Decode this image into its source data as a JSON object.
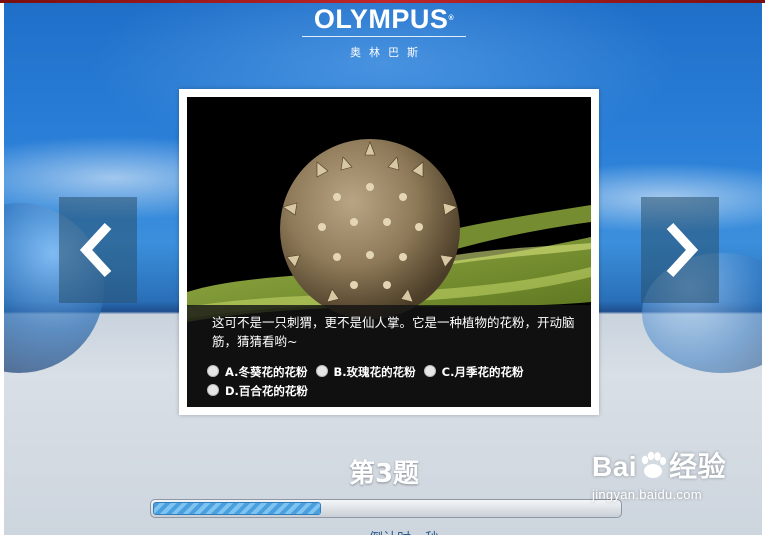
{
  "header": {
    "brand": "OLYMPUS",
    "brand_mark": "®",
    "brand_cn": "奥林巴斯"
  },
  "nav": {
    "prev_icon": "chevron-left-icon",
    "next_icon": "chevron-right-icon"
  },
  "quiz": {
    "question": "这可不是一只刺猬，更不是仙人掌。它是一种植物的花粉，开动脑筋，猜猜看哟~",
    "options": [
      {
        "label": "A.冬葵花的花粉"
      },
      {
        "label": "B.玫瑰花的花粉"
      },
      {
        "label": "C.月季花的花粉"
      },
      {
        "label": "D.百合花的花粉"
      }
    ],
    "number_label": "第3题",
    "progress_fraction": 0.36,
    "timer_text": "倒计时一秒"
  },
  "watermark": {
    "logo_left": "Bai",
    "logo_right": "经验",
    "url": "jingyan.baidu.com"
  },
  "colors": {
    "sky": "#2b80d8",
    "progress_fill": "#4aa0de",
    "top_strip": "#c0262a"
  }
}
